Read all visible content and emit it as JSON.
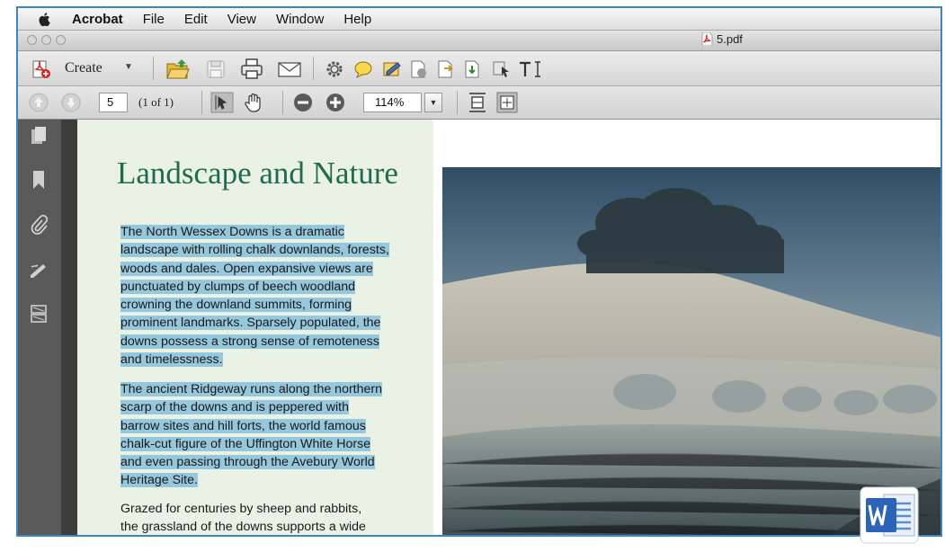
{
  "menubar": {
    "app_name": "Acrobat",
    "items": [
      "File",
      "Edit",
      "View",
      "Window",
      "Help"
    ]
  },
  "window": {
    "title": "5.pdf"
  },
  "toolbar": {
    "create_label": "Create",
    "icons": [
      "open-icon",
      "save-icon",
      "print-icon",
      "email-icon",
      "settings-icon",
      "comment-icon",
      "sign-icon",
      "pages-icon",
      "export-icon",
      "combine-icon",
      "select-icon",
      "text-icon"
    ]
  },
  "navigation": {
    "page_number": "5",
    "page_count_label": "(1 of 1)",
    "zoom": "114%"
  },
  "document": {
    "heading": "Landscape and Nature",
    "paragraphs": [
      {
        "lines": [
          "The North Wessex Downs is a dramatic",
          "landscape with rolling chalk downlands, forests,",
          "woods and dales. Open expansive views are",
          "punctuated by clumps of beech woodland",
          "crowning the downland summits, forming",
          "prominent landmarks. Sparsely populated, the",
          "downs possess a strong sense of remoteness",
          "and timelessness."
        ]
      },
      {
        "lines": [
          "The ancient Ridgeway runs along the northern",
          "scarp of the downs and is peppered with",
          "barrow sites and hill forts, the world famous",
          "chalk-cut figure of the Uffington White Horse",
          "and even passing through the Avebury World",
          "Heritage Site."
        ]
      },
      {
        "lines": [
          "Grazed for centuries by sheep and rabbits,",
          "the grassland of the downs supports a wide"
        ]
      }
    ]
  },
  "colors": {
    "heading": "#1f6b4e",
    "selection": "#95c7dd",
    "panel": "#eaf2e6",
    "frame": "#3b86c6"
  }
}
